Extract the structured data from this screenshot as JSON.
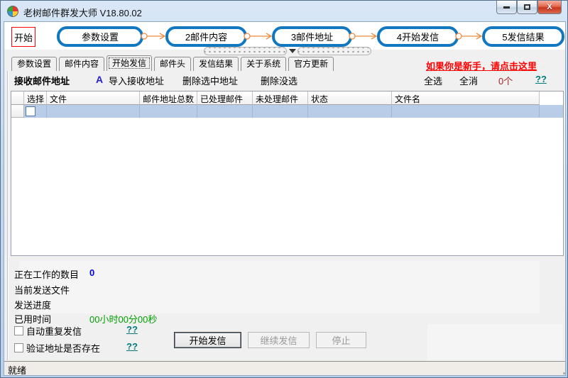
{
  "titlebar": {
    "title": "老树邮件群发大师 V18.80.02"
  },
  "workflow": {
    "start": "开始",
    "steps": [
      "参数设置",
      "2邮件内容",
      "3邮件地址",
      "4开始发信",
      "5发信结果"
    ]
  },
  "tabs": {
    "items": [
      "参数设置",
      "邮件内容",
      "开始发信",
      "邮件头",
      "发信结果",
      "关于系统",
      "官方更新"
    ],
    "selected": "开始发信",
    "newbie_link": "如果你是新手，请点击这里"
  },
  "toolbar": {
    "section_title": "接收邮件地址",
    "import_icon": "A",
    "import_label": "导入接收地址",
    "delete_selected_label": "删除选中地址",
    "delete_unselected_label": "删除没选",
    "select_all_label": "全选",
    "deselect_all_label": "全消",
    "count": "0个",
    "help": "??"
  },
  "table": {
    "columns": [
      "选择",
      "文件",
      "邮件地址总数",
      "已处理邮件",
      "未处理邮件",
      "状态",
      "文件名"
    ],
    "rows": [
      {
        "selected": false,
        "checked": false
      }
    ]
  },
  "status_panel": {
    "working_count_label": "正在工作的数目",
    "working_count_value": "0",
    "current_file_label": "当前发送文件",
    "current_file_value": "",
    "progress_label": "发送进度",
    "progress_value": "",
    "elapsed_label": "已用时间",
    "elapsed_value": "00小时00分00秒",
    "auto_repeat_label": "自动重复发信",
    "auto_repeat_help": "??",
    "verify_label": "验证地址是否存在",
    "verify_help": "??",
    "start_button": "开始发信",
    "continue_button": "继续发信",
    "stop_button": "停止"
  },
  "statusbar": {
    "text": "就绪"
  },
  "colors": {
    "pill_border": "#1177c0",
    "arrow_orange": "#ef8b3f",
    "highlight_row": "#b9cde9",
    "link_red": "#ff0000",
    "help_teal": "#007a7a",
    "value_blue": "#0000ee",
    "time_green": "#00a000",
    "close_button_red": "#c8371c"
  }
}
